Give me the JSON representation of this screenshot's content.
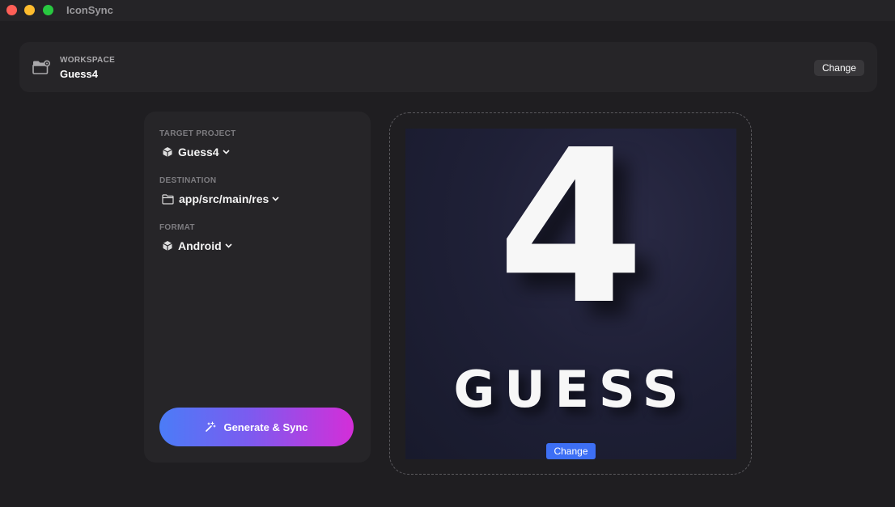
{
  "app": {
    "title": "IconSync"
  },
  "workspace": {
    "label": "WORKSPACE",
    "name": "Guess4",
    "change_label": "Change"
  },
  "settings": {
    "target_project": {
      "label": "TARGET PROJECT",
      "value": "Guess4",
      "icon": "cube-icon"
    },
    "destination": {
      "label": "DESTINATION",
      "value": "app/src/main/res",
      "icon": "folder-icon"
    },
    "format": {
      "label": "FORMAT",
      "value": "Android",
      "icon": "cube-icon"
    },
    "generate_label": "Generate & Sync"
  },
  "preview": {
    "image_number": "4",
    "image_word": "GUESS",
    "change_label": "Change"
  },
  "colors": {
    "accent": "#3d6ff5",
    "gradient_start": "#4b7cf7",
    "gradient_end": "#d42ed8"
  }
}
